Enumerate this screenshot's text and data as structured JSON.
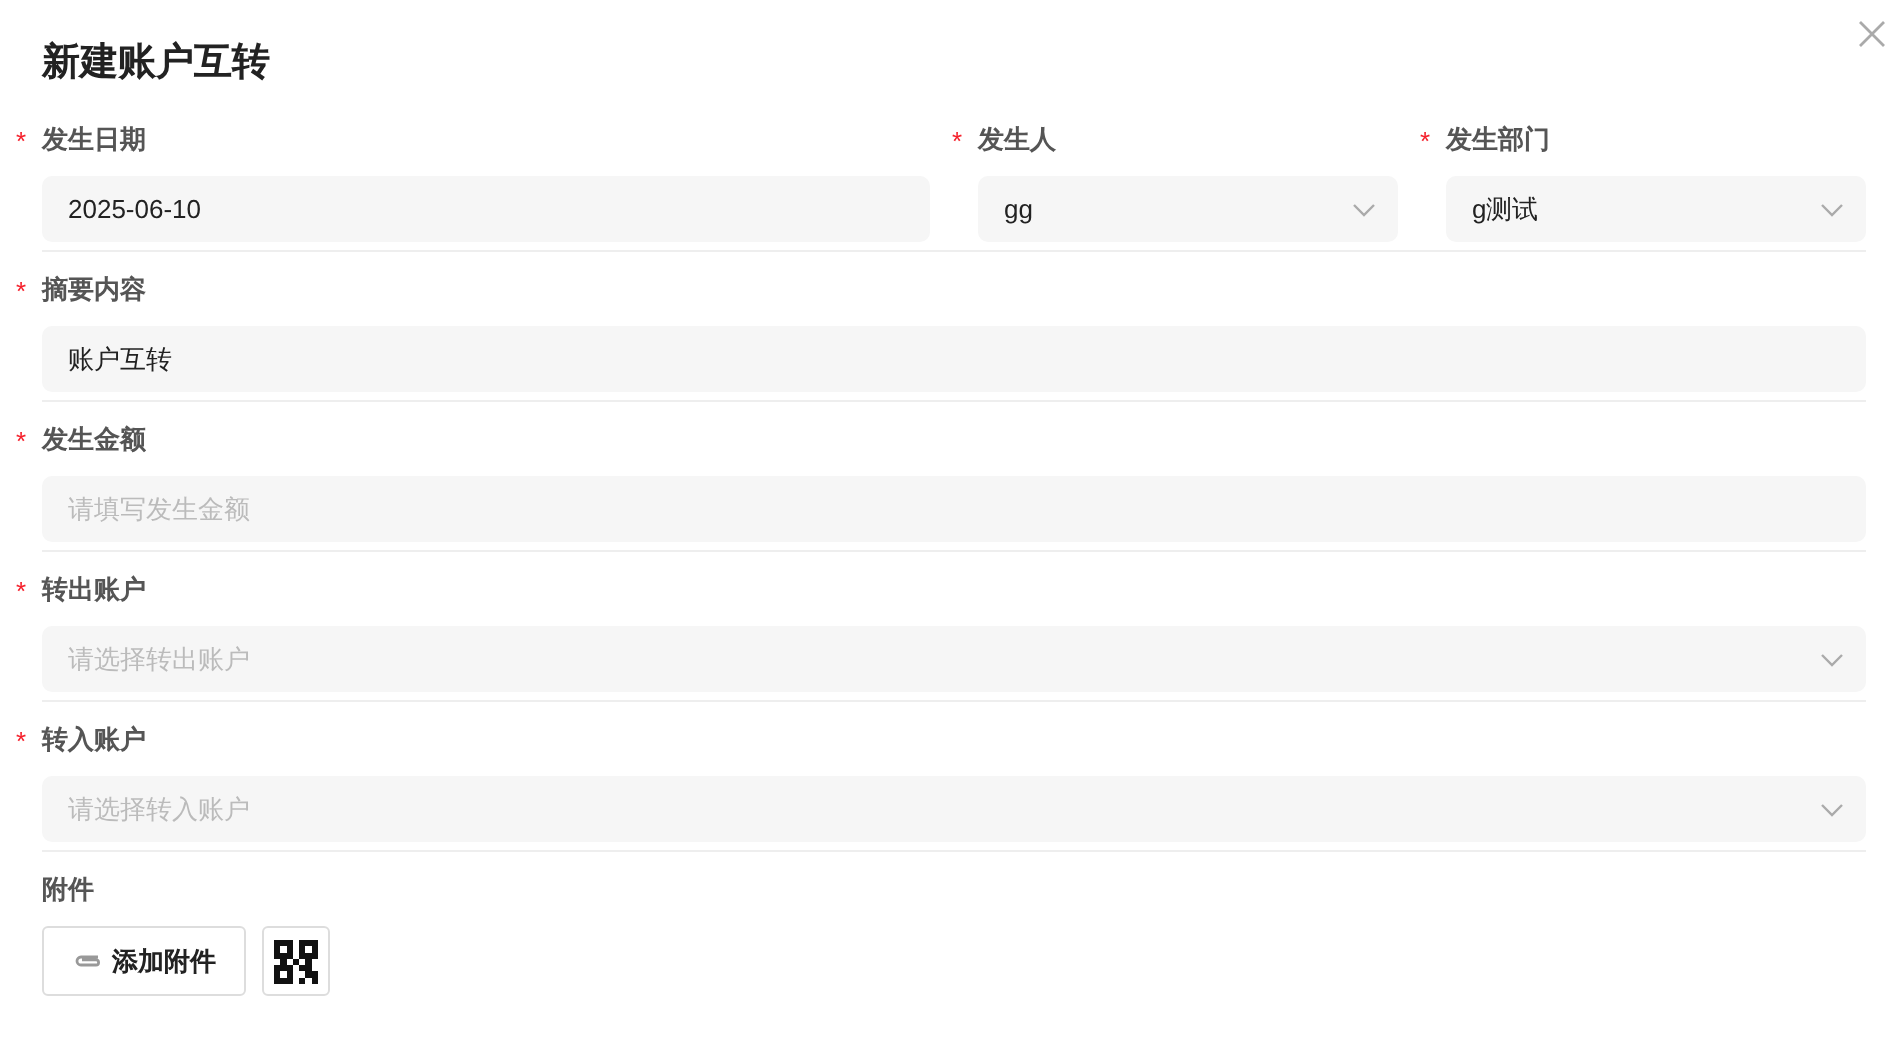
{
  "dialog": {
    "title": "新建账户互转"
  },
  "rows": [
    {
      "fields": [
        {
          "kind": "input",
          "label": "发生日期",
          "required_mark": "*",
          "value": "2025-06-10"
        },
        {
          "kind": "select",
          "label": "发生人",
          "required_mark": "*",
          "value": "gg"
        },
        {
          "kind": "select",
          "label": "发生部门",
          "required_mark": "*",
          "value": "g测试"
        }
      ]
    },
    {
      "fields": [
        {
          "kind": "input",
          "label": "摘要内容",
          "required_mark": "*",
          "value": "账户互转"
        }
      ]
    },
    {
      "fields": [
        {
          "kind": "input",
          "label": "发生金额",
          "required_mark": "*",
          "placeholder": "请填写发生金额"
        }
      ]
    },
    {
      "fields": [
        {
          "kind": "select",
          "label": "转出账户",
          "required_mark": "*",
          "placeholder": "请选择转出账户"
        }
      ]
    },
    {
      "fields": [
        {
          "kind": "select",
          "label": "转入账户",
          "required_mark": "*",
          "placeholder": "请选择转入账户"
        }
      ]
    }
  ],
  "attachments": {
    "label": "附件",
    "button": "添加附件"
  }
}
